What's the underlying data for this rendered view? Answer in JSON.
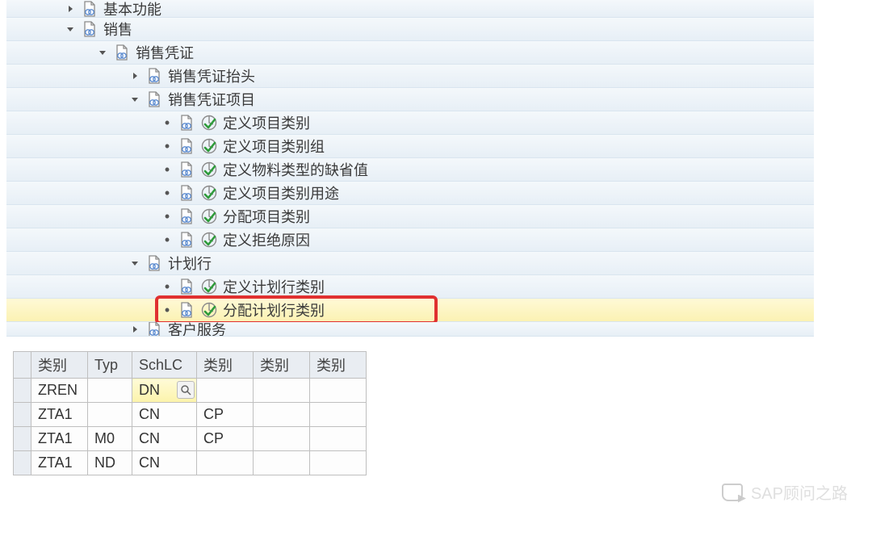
{
  "tree": {
    "rows": [
      {
        "indent": 70,
        "expander": "right",
        "doc": true,
        "check": false,
        "label": "基本功能",
        "cropTop": true
      },
      {
        "indent": 70,
        "expander": "down",
        "doc": true,
        "check": false,
        "label": "销售"
      },
      {
        "indent": 110,
        "expander": "down",
        "doc": true,
        "check": false,
        "label": "销售凭证"
      },
      {
        "indent": 150,
        "expander": "right",
        "doc": true,
        "check": false,
        "label": "销售凭证抬头"
      },
      {
        "indent": 150,
        "expander": "down",
        "doc": true,
        "check": false,
        "label": "销售凭证项目"
      },
      {
        "indent": 190,
        "bullet": true,
        "doc": true,
        "check": true,
        "label": "定义项目类别"
      },
      {
        "indent": 190,
        "bullet": true,
        "doc": true,
        "check": true,
        "label": "定义项目类别组"
      },
      {
        "indent": 190,
        "bullet": true,
        "doc": true,
        "check": true,
        "label": "定义物料类型的缺省值"
      },
      {
        "indent": 190,
        "bullet": true,
        "doc": true,
        "check": true,
        "label": "定义项目类别用途"
      },
      {
        "indent": 190,
        "bullet": true,
        "doc": true,
        "check": true,
        "label": "分配项目类别"
      },
      {
        "indent": 190,
        "bullet": true,
        "doc": true,
        "check": true,
        "label": "定义拒绝原因"
      },
      {
        "indent": 150,
        "expander": "down",
        "doc": true,
        "check": false,
        "label": "计划行"
      },
      {
        "indent": 190,
        "bullet": true,
        "doc": true,
        "check": true,
        "label": "定义计划行类别"
      },
      {
        "indent": 190,
        "bullet": true,
        "doc": true,
        "check": true,
        "label": "分配计划行类别",
        "highlighted": true,
        "boxed": true
      },
      {
        "indent": 150,
        "expander": "right",
        "doc": true,
        "check": false,
        "label": "客户服务",
        "cropBottom": true
      }
    ]
  },
  "table": {
    "headers": [
      "类别",
      "Typ",
      "SchLC",
      "类别",
      "类别",
      "类别"
    ],
    "editCell": {
      "row": 0,
      "col": 2,
      "value": "DN"
    },
    "rows": [
      [
        "ZREN",
        "",
        "DN",
        "",
        "",
        ""
      ],
      [
        "ZTA1",
        "",
        "CN",
        "CP",
        "",
        ""
      ],
      [
        "ZTA1",
        "M0",
        "CN",
        "CP",
        "",
        ""
      ],
      [
        "ZTA1",
        "ND",
        "CN",
        "",
        "",
        ""
      ]
    ]
  },
  "watermark": "SAP顾问之路"
}
